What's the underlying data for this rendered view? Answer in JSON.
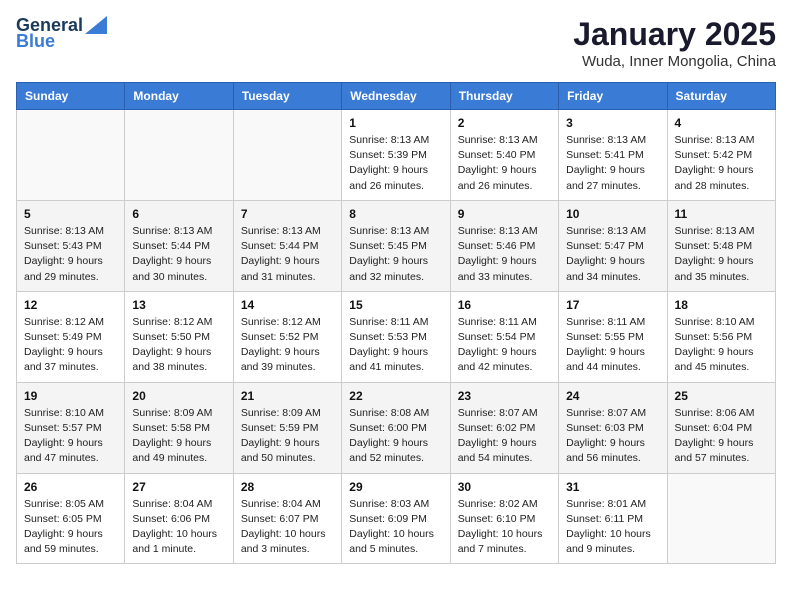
{
  "logo": {
    "line1": "General",
    "line2": "Blue"
  },
  "title": "January 2025",
  "location": "Wuda, Inner Mongolia, China",
  "days_header": [
    "Sunday",
    "Monday",
    "Tuesday",
    "Wednesday",
    "Thursday",
    "Friday",
    "Saturday"
  ],
  "weeks": [
    [
      {
        "num": "",
        "sunrise": "",
        "sunset": "",
        "daylight": ""
      },
      {
        "num": "",
        "sunrise": "",
        "sunset": "",
        "daylight": ""
      },
      {
        "num": "",
        "sunrise": "",
        "sunset": "",
        "daylight": ""
      },
      {
        "num": "1",
        "sunrise": "Sunrise: 8:13 AM",
        "sunset": "Sunset: 5:39 PM",
        "daylight": "Daylight: 9 hours and 26 minutes."
      },
      {
        "num": "2",
        "sunrise": "Sunrise: 8:13 AM",
        "sunset": "Sunset: 5:40 PM",
        "daylight": "Daylight: 9 hours and 26 minutes."
      },
      {
        "num": "3",
        "sunrise": "Sunrise: 8:13 AM",
        "sunset": "Sunset: 5:41 PM",
        "daylight": "Daylight: 9 hours and 27 minutes."
      },
      {
        "num": "4",
        "sunrise": "Sunrise: 8:13 AM",
        "sunset": "Sunset: 5:42 PM",
        "daylight": "Daylight: 9 hours and 28 minutes."
      }
    ],
    [
      {
        "num": "5",
        "sunrise": "Sunrise: 8:13 AM",
        "sunset": "Sunset: 5:43 PM",
        "daylight": "Daylight: 9 hours and 29 minutes."
      },
      {
        "num": "6",
        "sunrise": "Sunrise: 8:13 AM",
        "sunset": "Sunset: 5:44 PM",
        "daylight": "Daylight: 9 hours and 30 minutes."
      },
      {
        "num": "7",
        "sunrise": "Sunrise: 8:13 AM",
        "sunset": "Sunset: 5:44 PM",
        "daylight": "Daylight: 9 hours and 31 minutes."
      },
      {
        "num": "8",
        "sunrise": "Sunrise: 8:13 AM",
        "sunset": "Sunset: 5:45 PM",
        "daylight": "Daylight: 9 hours and 32 minutes."
      },
      {
        "num": "9",
        "sunrise": "Sunrise: 8:13 AM",
        "sunset": "Sunset: 5:46 PM",
        "daylight": "Daylight: 9 hours and 33 minutes."
      },
      {
        "num": "10",
        "sunrise": "Sunrise: 8:13 AM",
        "sunset": "Sunset: 5:47 PM",
        "daylight": "Daylight: 9 hours and 34 minutes."
      },
      {
        "num": "11",
        "sunrise": "Sunrise: 8:13 AM",
        "sunset": "Sunset: 5:48 PM",
        "daylight": "Daylight: 9 hours and 35 minutes."
      }
    ],
    [
      {
        "num": "12",
        "sunrise": "Sunrise: 8:12 AM",
        "sunset": "Sunset: 5:49 PM",
        "daylight": "Daylight: 9 hours and 37 minutes."
      },
      {
        "num": "13",
        "sunrise": "Sunrise: 8:12 AM",
        "sunset": "Sunset: 5:50 PM",
        "daylight": "Daylight: 9 hours and 38 minutes."
      },
      {
        "num": "14",
        "sunrise": "Sunrise: 8:12 AM",
        "sunset": "Sunset: 5:52 PM",
        "daylight": "Daylight: 9 hours and 39 minutes."
      },
      {
        "num": "15",
        "sunrise": "Sunrise: 8:11 AM",
        "sunset": "Sunset: 5:53 PM",
        "daylight": "Daylight: 9 hours and 41 minutes."
      },
      {
        "num": "16",
        "sunrise": "Sunrise: 8:11 AM",
        "sunset": "Sunset: 5:54 PM",
        "daylight": "Daylight: 9 hours and 42 minutes."
      },
      {
        "num": "17",
        "sunrise": "Sunrise: 8:11 AM",
        "sunset": "Sunset: 5:55 PM",
        "daylight": "Daylight: 9 hours and 44 minutes."
      },
      {
        "num": "18",
        "sunrise": "Sunrise: 8:10 AM",
        "sunset": "Sunset: 5:56 PM",
        "daylight": "Daylight: 9 hours and 45 minutes."
      }
    ],
    [
      {
        "num": "19",
        "sunrise": "Sunrise: 8:10 AM",
        "sunset": "Sunset: 5:57 PM",
        "daylight": "Daylight: 9 hours and 47 minutes."
      },
      {
        "num": "20",
        "sunrise": "Sunrise: 8:09 AM",
        "sunset": "Sunset: 5:58 PM",
        "daylight": "Daylight: 9 hours and 49 minutes."
      },
      {
        "num": "21",
        "sunrise": "Sunrise: 8:09 AM",
        "sunset": "Sunset: 5:59 PM",
        "daylight": "Daylight: 9 hours and 50 minutes."
      },
      {
        "num": "22",
        "sunrise": "Sunrise: 8:08 AM",
        "sunset": "Sunset: 6:00 PM",
        "daylight": "Daylight: 9 hours and 52 minutes."
      },
      {
        "num": "23",
        "sunrise": "Sunrise: 8:07 AM",
        "sunset": "Sunset: 6:02 PM",
        "daylight": "Daylight: 9 hours and 54 minutes."
      },
      {
        "num": "24",
        "sunrise": "Sunrise: 8:07 AM",
        "sunset": "Sunset: 6:03 PM",
        "daylight": "Daylight: 9 hours and 56 minutes."
      },
      {
        "num": "25",
        "sunrise": "Sunrise: 8:06 AM",
        "sunset": "Sunset: 6:04 PM",
        "daylight": "Daylight: 9 hours and 57 minutes."
      }
    ],
    [
      {
        "num": "26",
        "sunrise": "Sunrise: 8:05 AM",
        "sunset": "Sunset: 6:05 PM",
        "daylight": "Daylight: 9 hours and 59 minutes."
      },
      {
        "num": "27",
        "sunrise": "Sunrise: 8:04 AM",
        "sunset": "Sunset: 6:06 PM",
        "daylight": "Daylight: 10 hours and 1 minute."
      },
      {
        "num": "28",
        "sunrise": "Sunrise: 8:04 AM",
        "sunset": "Sunset: 6:07 PM",
        "daylight": "Daylight: 10 hours and 3 minutes."
      },
      {
        "num": "29",
        "sunrise": "Sunrise: 8:03 AM",
        "sunset": "Sunset: 6:09 PM",
        "daylight": "Daylight: 10 hours and 5 minutes."
      },
      {
        "num": "30",
        "sunrise": "Sunrise: 8:02 AM",
        "sunset": "Sunset: 6:10 PM",
        "daylight": "Daylight: 10 hours and 7 minutes."
      },
      {
        "num": "31",
        "sunrise": "Sunrise: 8:01 AM",
        "sunset": "Sunset: 6:11 PM",
        "daylight": "Daylight: 10 hours and 9 minutes."
      },
      {
        "num": "",
        "sunrise": "",
        "sunset": "",
        "daylight": ""
      }
    ]
  ]
}
